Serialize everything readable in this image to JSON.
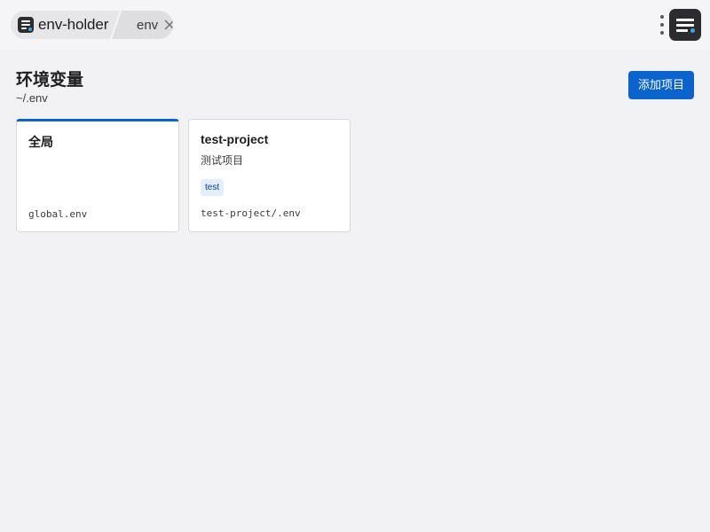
{
  "topbar": {
    "app_name": "env-holder",
    "tab_name": "env",
    "close_icon": "close-icon",
    "more_icon": "more-vertical-icon",
    "menu_icon": "menu-icon"
  },
  "header": {
    "title": "环境变量",
    "path": "~/.env",
    "add_button_label": "添加项目"
  },
  "cards": [
    {
      "title": "全局",
      "description": "",
      "tag": "",
      "file": "global.env",
      "active": true
    },
    {
      "title": "test-project",
      "description": "测试项目",
      "tag": "test",
      "file": "test-project/.env",
      "active": false
    }
  ],
  "colors": {
    "accent": "#0b63ce",
    "background": "#f2f2f4",
    "tag_background": "#e4eefb",
    "icon_dark": "#2c2c30",
    "icon_dot": "#3aa6e8"
  }
}
